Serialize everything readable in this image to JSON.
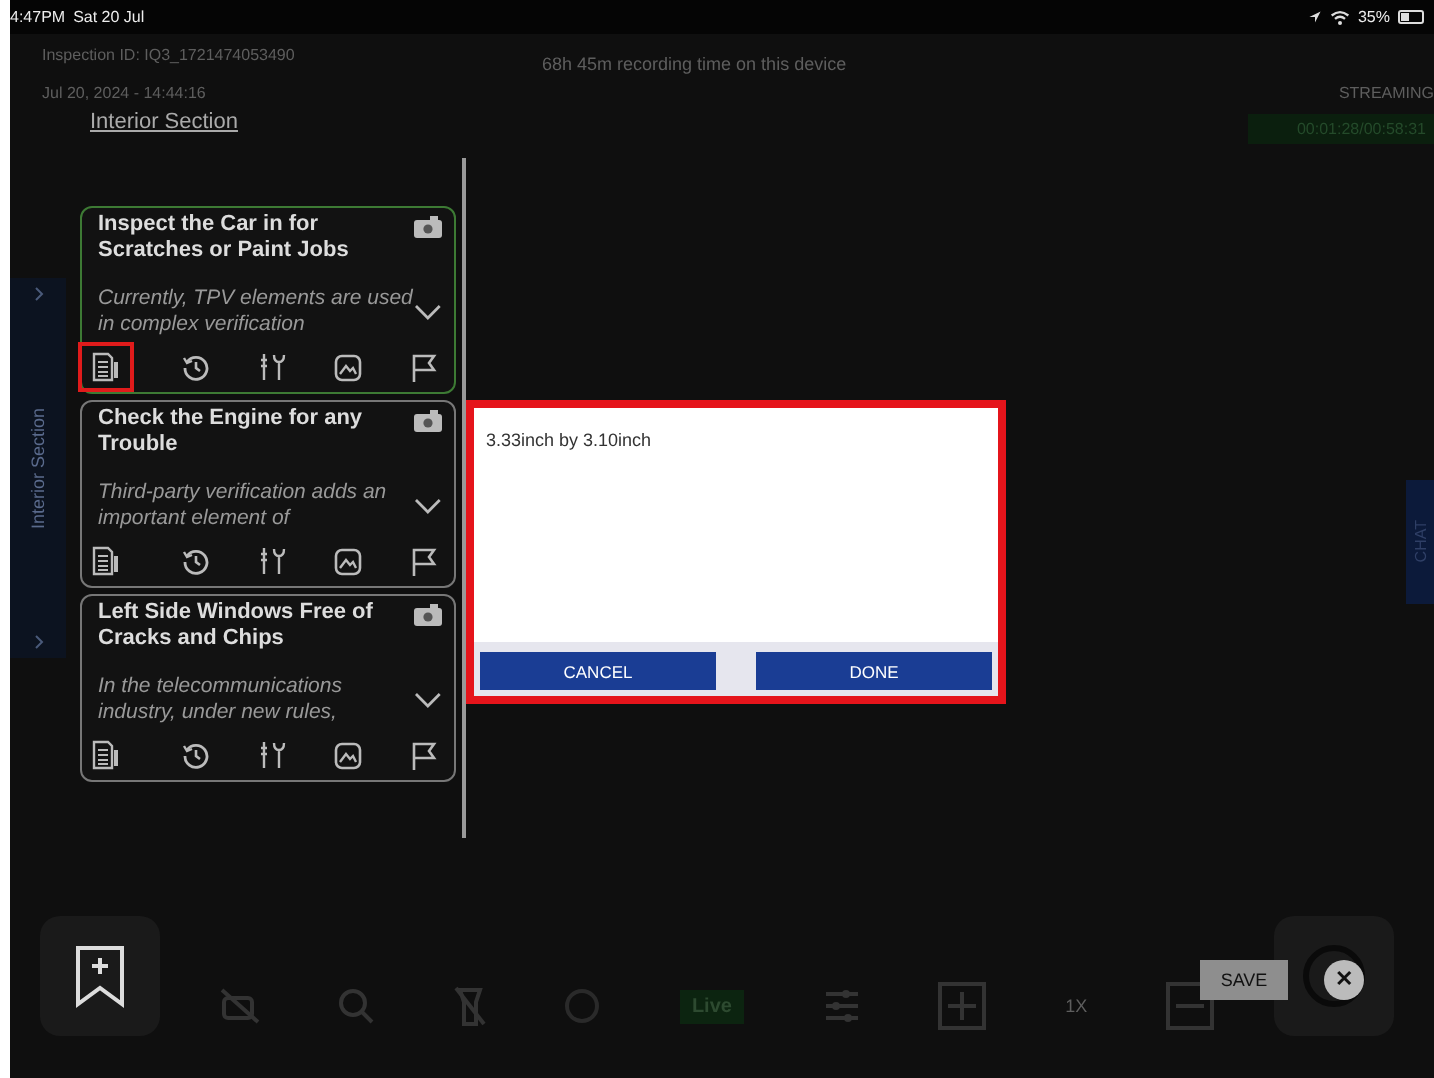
{
  "status_bar": {
    "time": "4:47PM",
    "date": "Sat 20 Jul",
    "battery": "35%"
  },
  "header": {
    "inspection_id": "Inspection ID: IQ3_1721474053490",
    "recording_time": "68h 45m recording time on this device",
    "timestamp": "Jul 20, 2024 - 14:44:16",
    "stream_status": "STREAMING",
    "timer": "00:01:28/00:58:31",
    "section_link": "Interior Section"
  },
  "side_panel": {
    "label": "Interior Section"
  },
  "checklist": [
    {
      "title": "Inspect the Car in for Scratches or Paint Jobs",
      "description": "Currently, TPV elements are used in complex verification",
      "selected": true,
      "notes_marked": true
    },
    {
      "title": "Check the Engine for any Trouble",
      "description": "Third-party verification adds an important element of",
      "selected": false,
      "notes_marked": false
    },
    {
      "title": "Left Side Windows Free of Cracks and Chips",
      "description": "In the telecommunications industry, under new rules,",
      "selected": false,
      "notes_marked": false
    }
  ],
  "dialog": {
    "text": "3.33inch by 3.10inch",
    "buttons": [
      "CANCEL",
      "DONE"
    ]
  },
  "chat_tab": {
    "label": "CHAT"
  },
  "toolbar": {
    "live": "Live",
    "zoom": "1X"
  },
  "save_popup": {
    "label": "SAVE",
    "close": "✕"
  }
}
